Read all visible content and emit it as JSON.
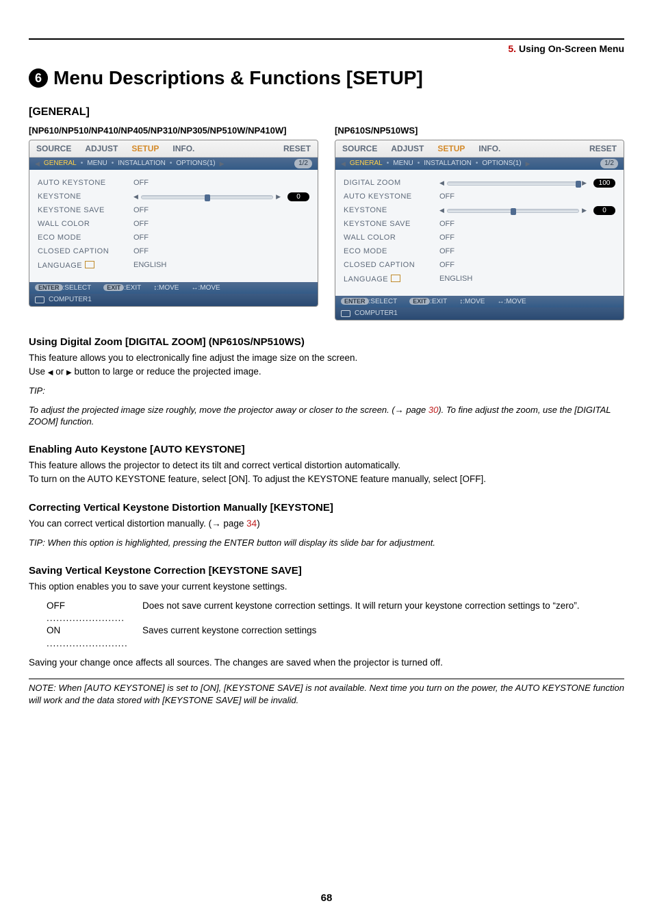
{
  "header": {
    "section_num": "5.",
    "section_title": "Using On-Screen Menu"
  },
  "main_title": {
    "bullet": "6",
    "text": "Menu Descriptions & Functions [SETUP]"
  },
  "general_heading": "[GENERAL]",
  "models": {
    "left_label": "[NP610/NP510/NP410/NP405/NP310/NP305/NP510W/NP410W]",
    "right_label": "[NP610S/NP510WS]"
  },
  "osd_common": {
    "tabs": {
      "source": "SOURCE",
      "adjust": "ADJUST",
      "setup": "SETUP",
      "info": "INFO.",
      "reset": "RESET"
    },
    "subtabs": {
      "general": "GENERAL",
      "menu": "MENU",
      "installation": "INSTALLATION",
      "options1": "OPTIONS(1)",
      "page": "1/2"
    },
    "footer": {
      "enter": "ENTER",
      "enter_label": ":SELECT",
      "exit": "EXIT",
      "exit_label": ":EXIT",
      "ud": "↕:MOVE",
      "lr": "↔:MOVE",
      "src": "COMPUTER1"
    }
  },
  "osd_left": {
    "rows": [
      {
        "label": "AUTO KEYSTONE",
        "type": "text",
        "value": "OFF"
      },
      {
        "label": "KEYSTONE",
        "type": "slider",
        "pos": 50,
        "badge": "0"
      },
      {
        "label": "KEYSTONE SAVE",
        "type": "text",
        "value": "OFF"
      },
      {
        "label": "WALL COLOR",
        "type": "text",
        "value": "OFF"
      },
      {
        "label": "ECO MODE",
        "type": "text",
        "value": "OFF"
      },
      {
        "label": "CLOSED CAPTION",
        "type": "text",
        "value": "OFF"
      },
      {
        "label": "LANGUAGE",
        "type": "lang",
        "value": "ENGLISH"
      }
    ]
  },
  "osd_right": {
    "rows": [
      {
        "label": "DIGITAL ZOOM",
        "type": "slider",
        "pos": 100,
        "badge": "100"
      },
      {
        "label": "AUTO KEYSTONE",
        "type": "text",
        "value": "OFF"
      },
      {
        "label": "KEYSTONE",
        "type": "slider",
        "pos": 50,
        "badge": "0"
      },
      {
        "label": "KEYSTONE SAVE",
        "type": "text",
        "value": "OFF"
      },
      {
        "label": "WALL COLOR",
        "type": "text",
        "value": "OFF"
      },
      {
        "label": "ECO MODE",
        "type": "text",
        "value": "OFF"
      },
      {
        "label": "CLOSED CAPTION",
        "type": "text",
        "value": "OFF"
      },
      {
        "label": "LANGUAGE",
        "type": "lang",
        "value": "ENGLISH"
      }
    ]
  },
  "sections": {
    "digital_zoom": {
      "heading": "Using Digital Zoom [DIGITAL ZOOM] (NP610S/NP510WS)",
      "p1": "This feature allows you to electronically fine adjust the image size on the screen.",
      "p2a": "Use ",
      "p2b": " or ",
      "p2c": " button to large or reduce the projected image.",
      "tip_label": "TIP:",
      "tip_a": "To adjust the projected image size roughly, move the projector away or closer to the screen. (→ page ",
      "tip_page": "30",
      "tip_b": "). To fine adjust the zoom, use the [DIGITAL ZOOM] function."
    },
    "auto_keystone": {
      "heading": "Enabling Auto Keystone [AUTO KEYSTONE]",
      "p1": "This feature allows the projector to detect its tilt and correct vertical distortion automatically.",
      "p2": "To turn on the AUTO KEYSTONE feature, select [ON]. To adjust the KEYSTONE feature manually, select [OFF]."
    },
    "keystone_manual": {
      "heading": "Correcting Vertical Keystone Distortion Manually [KEYSTONE]",
      "p1a": "You can correct vertical distortion manually. (→ page ",
      "p1_page": "34",
      "p1b": ")",
      "tip": "TIP: When this option is highlighted, pressing the ENTER button will display its slide bar for adjustment."
    },
    "keystone_save": {
      "heading": "Saving Vertical Keystone Correction [KEYSTONE SAVE]",
      "p1": "This option enables you to save your current keystone settings.",
      "off_term": "OFF",
      "off_desc": "Does not save current keystone correction settings. It will return your keystone correction settings to “zero”.",
      "on_term": "ON",
      "on_desc": "Saves current keystone correction settings",
      "p2": "Saving your change once affects all sources. The changes are saved when the projector is turned off.",
      "note": "NOTE: When [AUTO KEYSTONE] is set to [ON], [KEYSTONE SAVE] is not available. Next time you turn on the power, the AUTO KEYSTONE function will work and the data stored with [KEYSTONE SAVE] will be invalid."
    }
  },
  "page_number": "68"
}
